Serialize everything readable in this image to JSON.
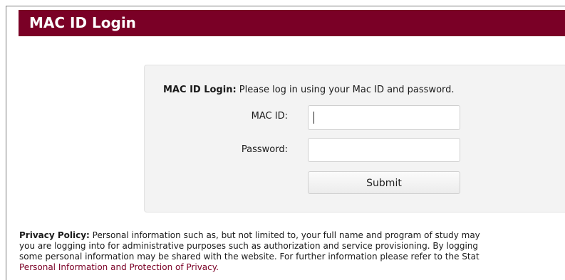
{
  "header": {
    "title": "MAC ID Login"
  },
  "login": {
    "intro_bold": "MAC ID Login:",
    "intro_text": " Please log in using your Mac ID and password.",
    "macid_label": "MAC ID:",
    "macid_value": "",
    "password_label": "Password:",
    "password_value": "",
    "submit_label": "Submit"
  },
  "privacy": {
    "heading": "Privacy Policy:",
    "line1": " Personal information such as, but not limited to, your full name and program of study may",
    "line2": "you are logging into for administrative purposes such as authorization and service provisioning. By logging",
    "line3": "some personal information may be shared with the website. For further information please refer to the Stat",
    "link": "Personal Information and Protection of Privacy."
  },
  "colors": {
    "brand": "#7a0026",
    "panel_bg": "#f3f3f3"
  }
}
